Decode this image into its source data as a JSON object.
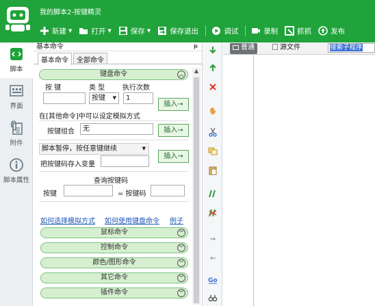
{
  "window": {
    "title": "我的脚本2-按键精灵"
  },
  "toolbar": [
    {
      "label": "新建",
      "icon": "plus-icon",
      "dropdown": true
    },
    {
      "label": "打开",
      "icon": "folder-icon",
      "dropdown": true
    },
    {
      "label": "保存",
      "icon": "save-icon",
      "dropdown": true
    },
    {
      "label": "保存退出",
      "icon": "save-exit-icon",
      "dropdown": false
    },
    {
      "label": "调试",
      "icon": "play-icon",
      "dropdown": false
    },
    {
      "label": "录制",
      "icon": "camera-icon",
      "dropdown": false
    },
    {
      "label": "抓抓",
      "icon": "capture-icon",
      "dropdown": false
    },
    {
      "label": "发布",
      "icon": "publish-icon",
      "dropdown": false
    }
  ],
  "leftnav": [
    {
      "label": "脚本",
      "icon": "script-icon"
    },
    {
      "label": "界面",
      "icon": "layout-icon"
    },
    {
      "label": "附件",
      "icon": "attachment-icon"
    },
    {
      "label": "脚本属性",
      "icon": "info-icon"
    }
  ],
  "panel": {
    "title": "基本命令",
    "pin": "ᵽ",
    "tabs": [
      "基本命令",
      "全部命令"
    ],
    "keyboard": {
      "header": "键盘命令",
      "col_key": "按 键",
      "col_type": "类 型",
      "col_count": "执行次数",
      "type_value": "按键",
      "count_value": "1",
      "insert": "插入→",
      "hint": "在[其他命令]中可以设定模拟方式",
      "combo_label": "按键组合",
      "combo_value": "无",
      "pause_option": "脚本暂停，按任意键继续",
      "save_key_label": "把按键码存入变量",
      "query_title": "查询按键码",
      "query_key_label": "按键",
      "query_code_label": "= 按键码",
      "link_sim": "如何选择模拟方式",
      "link_usage": "如何使用键盘命令",
      "link_example": "例子"
    },
    "sections": [
      "鼠标命令",
      "控制命令",
      "颜色/图形命令",
      "其它命令",
      "插件命令"
    ]
  },
  "editor": {
    "tabs": [
      "普通",
      "源文件"
    ],
    "search_placeholder": "搜索子程序"
  },
  "colors": {
    "brand": "#1fa33a",
    "section_bg": "#d6efd0",
    "link": "#1a56b8"
  }
}
